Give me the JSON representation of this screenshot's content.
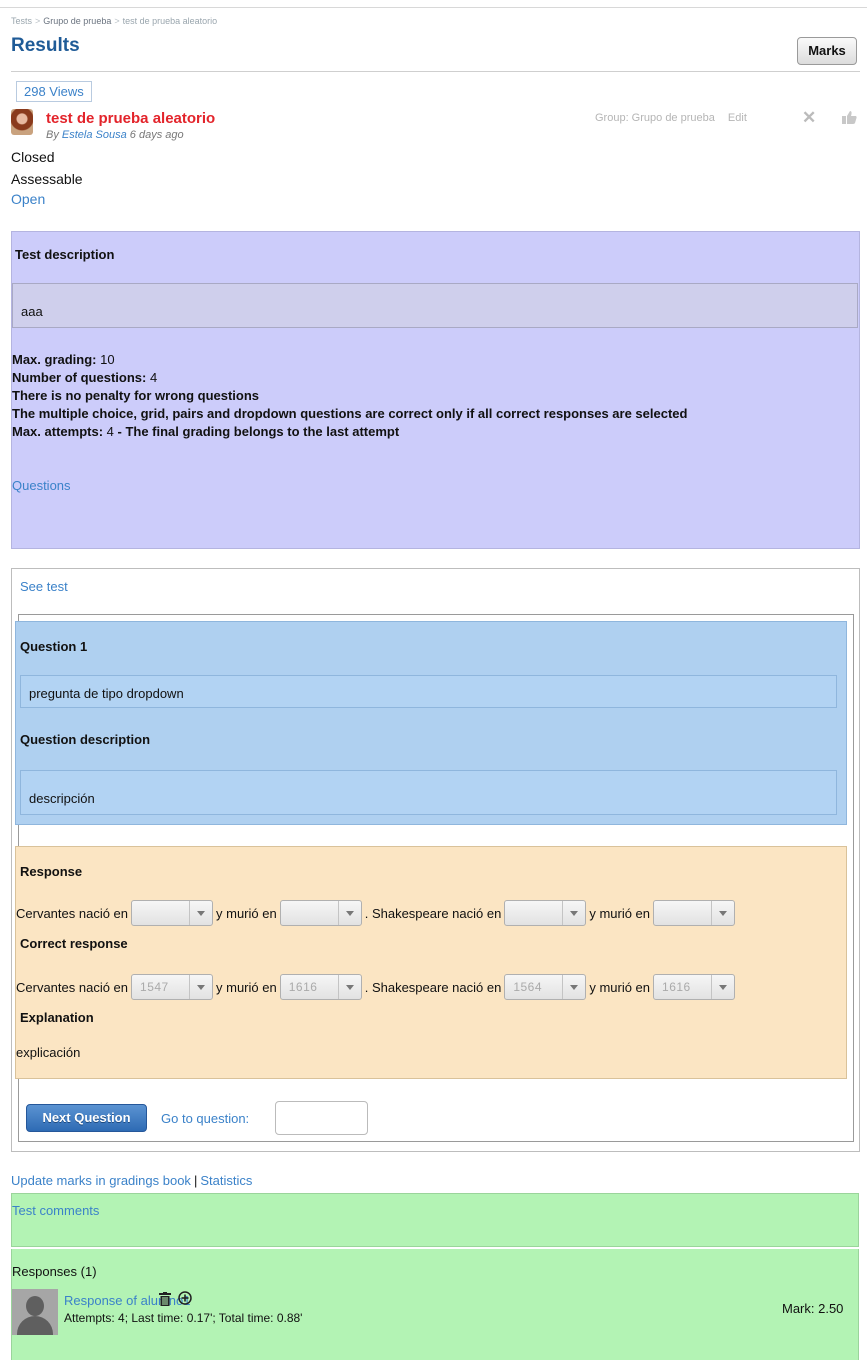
{
  "breadcrumb": [
    "Tests",
    "Grupo de prueba",
    "test de prueba aleatorio"
  ],
  "header": {
    "title": "Results",
    "marks_button": "Marks"
  },
  "post": {
    "views": "298 Views",
    "title": "test de prueba aleatorio",
    "by_prefix": "By",
    "author": "Estela Sousa",
    "time_ago": "6 days ago",
    "status": [
      "Closed",
      "Assessable"
    ],
    "open_link": "Open",
    "group_label": "Group: Grupo de prueba",
    "edit_label": "Edit"
  },
  "description_panel": {
    "heading": "Test description",
    "text": "aaa",
    "max_grading_label": "Max. grading:",
    "max_grading_value": "10",
    "num_questions_label": "Number of questions:",
    "num_questions_value": "4",
    "penalty_note": "There is no penalty for wrong questions",
    "multi_note": "The multiple choice, grid, pairs and dropdown questions are correct only if all correct responses are selected",
    "max_attempts_label": "Max. attempts:",
    "max_attempts_value": "4",
    "final_grading_note": "- The final grading belongs to the last attempt",
    "questions_link": "Questions"
  },
  "test_frame": {
    "see_test": "See test",
    "question": {
      "heading": "Question 1",
      "text": "pregunta de tipo dropdown",
      "desc_heading": "Question description",
      "desc_text": "descripción"
    },
    "response": {
      "heading": "Response",
      "correct_heading": "Correct response",
      "explanation_heading": "Explanation",
      "explanation_text": "explicación",
      "s1": "Cervantes nació en",
      "s2": "y murió en",
      "s3": ". Shakespeare nació en",
      "s4": "y murió en",
      "correct_values": [
        "1547",
        "1616",
        "1564",
        "1616"
      ]
    },
    "next_button": "Next Question",
    "goto_label": "Go to question:",
    "goto_value": ""
  },
  "footer": {
    "update_link": "Update marks in gradings book",
    "stats_link": "Statistics",
    "comments_link": "Test comments",
    "responses_heading": "Responses (1)",
    "response_link": "Response of alumno1",
    "attempts_text": "Attempts: 4; Last time: 0.17'; Total time: 0.88'",
    "mark": "Mark: 2.50"
  },
  "colors": {
    "link": "#3b82c9",
    "title": "#1f5b97",
    "description_panel": "#ccccfa",
    "question_panel": "#afd0f0",
    "response_panel": "#fbe5c3",
    "comments_panel": "#b3f3b4",
    "post_title": "#e3242b"
  },
  "icons": [
    "delete-x-icon",
    "like-thumb-icon",
    "trash-icon",
    "add-circle-icon",
    "author-avatar",
    "user-avatar"
  ]
}
